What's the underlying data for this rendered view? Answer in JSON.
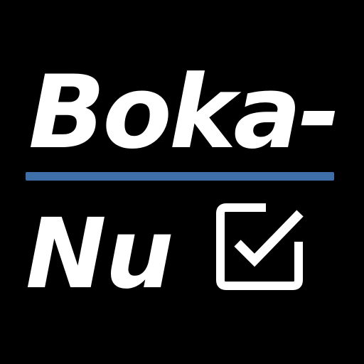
{
  "logo": {
    "line1": "Boka-",
    "line2": "Nu",
    "icon": "checkbox-checked-icon"
  },
  "colors": {
    "background": "#000000",
    "text": "#ffffff",
    "divider": "#3f6fa8"
  }
}
